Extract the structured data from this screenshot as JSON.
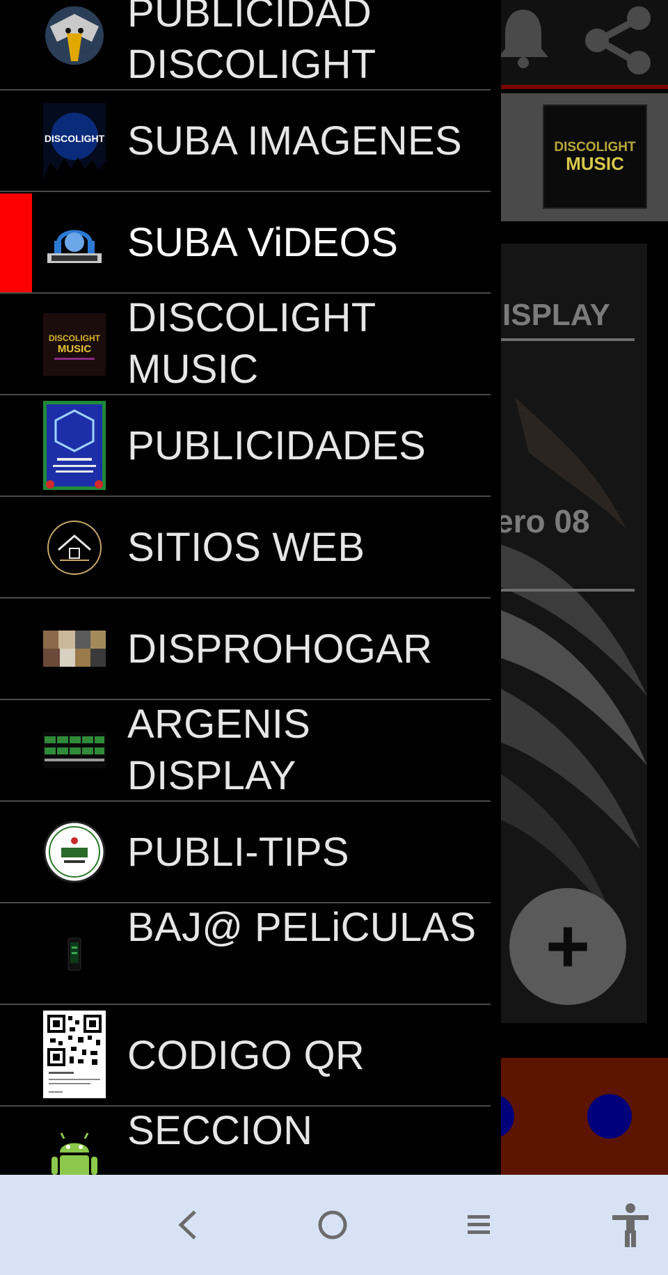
{
  "background": {
    "banner_text_top": "DISCOLIGHT",
    "banner_text_bottom": "MUSIC",
    "card_title": "ISPLAY",
    "card_date": "ero 08"
  },
  "drawer": {
    "items": [
      {
        "label": "PUBLICIDAD DISCOLIGHT",
        "icon": "eagle-icon",
        "active": false
      },
      {
        "label": "SUBA IMAGENES",
        "icon": "discolight-concert-icon",
        "active": false
      },
      {
        "label": "SUBA ViDEOS",
        "icon": "dj-headphones-icon",
        "active": true
      },
      {
        "label": "DISCOLIGHT MUSIC",
        "icon": "discolight-music-logo-icon",
        "active": false
      },
      {
        "label": "PUBLICIDADES",
        "icon": "flyer-icon",
        "active": false
      },
      {
        "label": "SITIOS WEB",
        "icon": "house-logo-icon",
        "active": false
      },
      {
        "label": "DISPROHOGAR",
        "icon": "photo-collage-icon",
        "active": false
      },
      {
        "label": "ARGENIS DISPLAY",
        "icon": "display-grid-icon",
        "active": false
      },
      {
        "label": "PUBLI-TIPS",
        "icon": "round-badge-icon",
        "active": false
      },
      {
        "label": "BAJ@ PELiCULAS",
        "icon": "phone-movie-icon",
        "active": false
      },
      {
        "label": "CODIGO QR",
        "icon": "qr-code-icon",
        "active": false
      },
      {
        "label": "SECCION",
        "icon": "android-icon",
        "active": false
      }
    ]
  },
  "colors": {
    "active_indicator": "#ff0000",
    "drawer_bg": "#000000",
    "system_nav_bg": "#d7e3f4"
  },
  "system_nav": {
    "back": "back-icon",
    "home": "home-icon",
    "recents": "recents-icon",
    "accessibility": "accessibility-icon"
  }
}
